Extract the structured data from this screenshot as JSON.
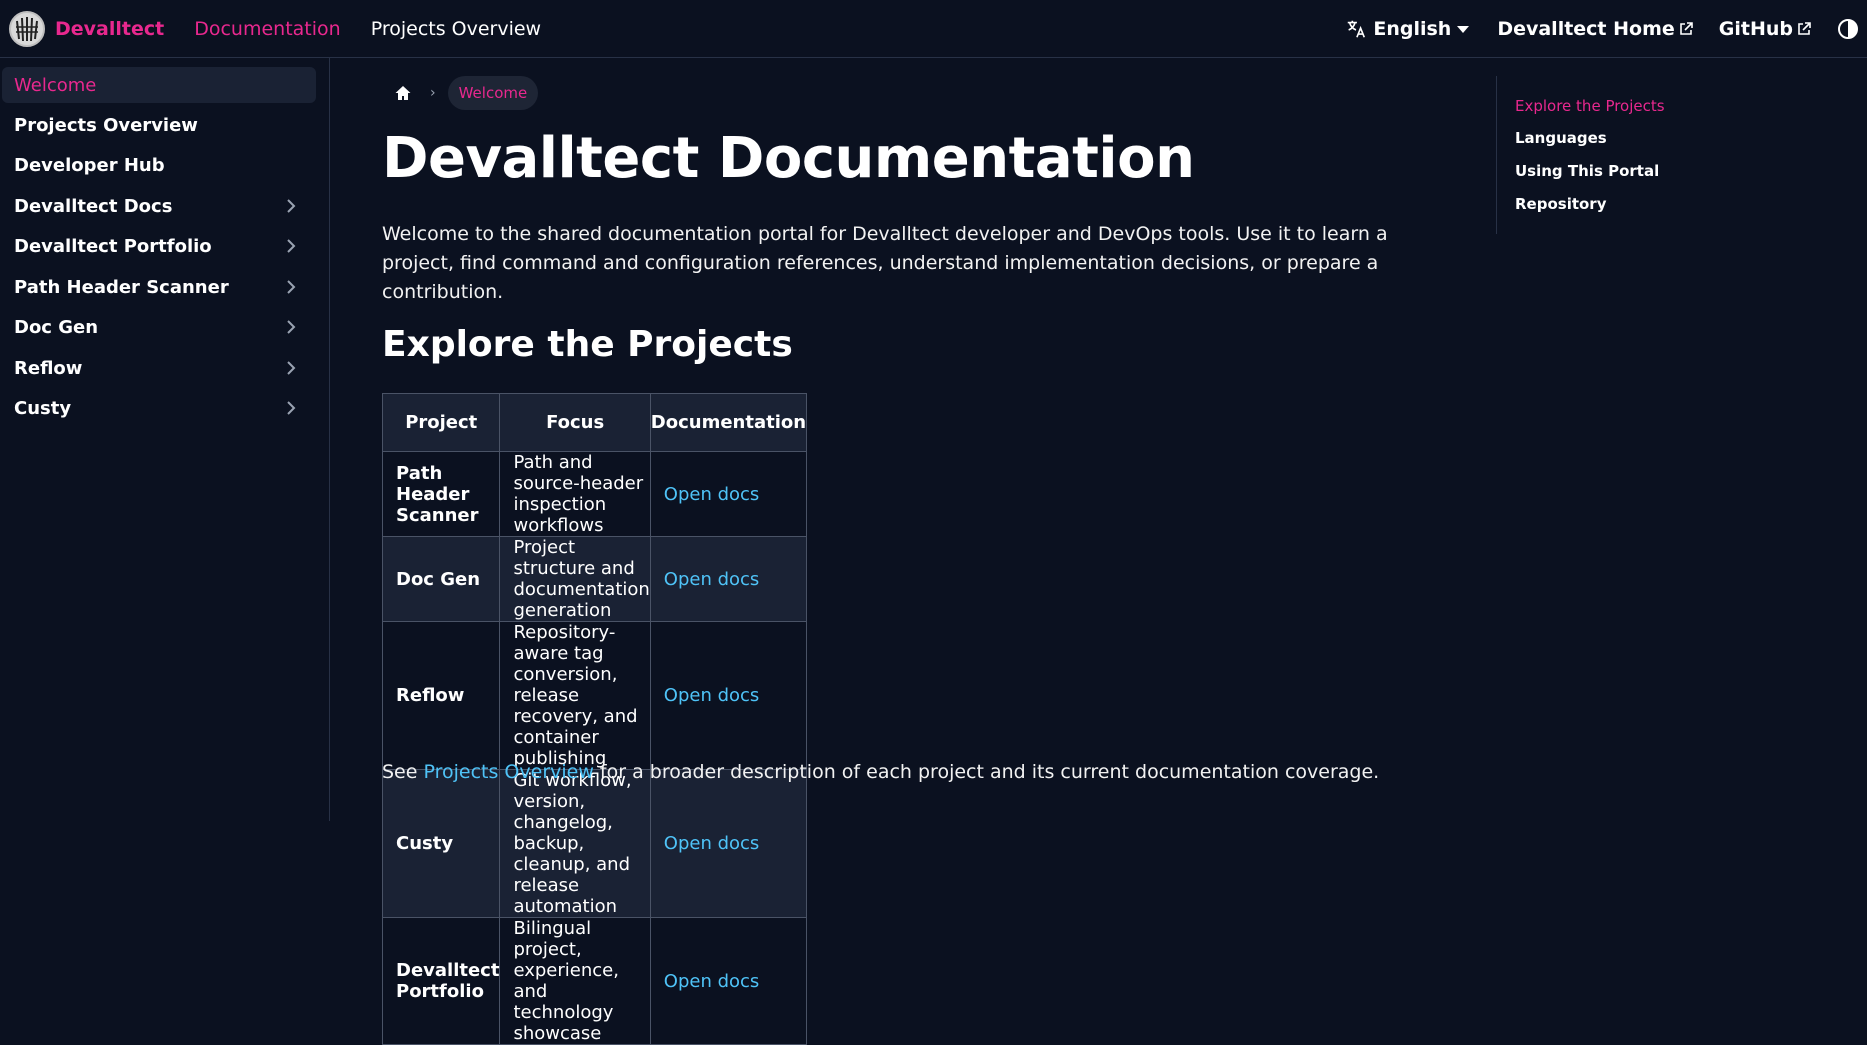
{
  "navbar": {
    "brand": "Devalltect",
    "links": [
      {
        "label": "Documentation"
      },
      {
        "label": "Projects Overview"
      }
    ],
    "language": "English",
    "home_link": "Devalltect Home",
    "github_link": "GitHub"
  },
  "sidebar": {
    "items": [
      {
        "label": "Welcome"
      },
      {
        "label": "Projects Overview"
      },
      {
        "label": "Developer Hub"
      },
      {
        "label": "Devalltect Docs"
      },
      {
        "label": "Devalltect Portfolio"
      },
      {
        "label": "Path Header Scanner"
      },
      {
        "label": "Doc Gen"
      },
      {
        "label": "Reflow"
      },
      {
        "label": "Custy"
      }
    ]
  },
  "breadcrumb": {
    "current": "Welcome"
  },
  "main": {
    "title": "Devalltect Documentation",
    "intro": "Welcome to the shared documentation portal for Devalltect developer and DevOps tools. Use it to learn a project, find command and configuration references, understand implementation decisions, or prepare a contribution.",
    "section_title": "Explore the Projects",
    "table": {
      "headers": [
        "Project",
        "Focus",
        "Documentation"
      ],
      "rows": [
        {
          "project": "Path Header Scanner",
          "focus": "Path and source-header inspection workflows",
          "doc": "Open docs"
        },
        {
          "project": "Doc Gen",
          "focus": "Project structure and documentation generation",
          "doc": "Open docs"
        },
        {
          "project": "Reflow",
          "focus": "Repository-aware tag conversion, release recovery, and container publishing",
          "doc": "Open docs"
        },
        {
          "project": "Custy",
          "focus": "Git workflow, version, changelog, backup, cleanup, and release automation",
          "doc": "Open docs"
        },
        {
          "project": "Devalltect Portfolio",
          "focus": "Bilingual project, experience, and technology showcase",
          "doc": "Open docs"
        }
      ]
    },
    "see_prefix": "See ",
    "see_link": "Projects Overview",
    "see_suffix": " for a broader description of each project and its current documentation coverage."
  },
  "toc": {
    "items": [
      {
        "label": "Explore the Projects"
      },
      {
        "label": "Languages"
      },
      {
        "label": "Using This Portal"
      },
      {
        "label": "Repository"
      }
    ]
  },
  "colors": {
    "background": "#0b1120",
    "accent": "#e8288e",
    "link": "#4fc3f7",
    "panel": "#1a2234"
  }
}
